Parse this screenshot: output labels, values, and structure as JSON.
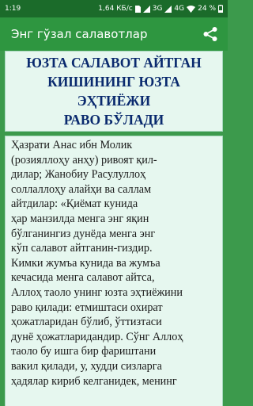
{
  "status_bar": {
    "time": "1:19",
    "network_speed": "1,64 КБ/с",
    "network_3g": "3G",
    "network_4g": "4G",
    "battery": "24 %",
    "icons": [
      "sim-icon",
      "signal-icon",
      "wifi-icon",
      "battery-icon"
    ]
  },
  "app_bar": {
    "title": "Энг гўзал салавотлар",
    "share_icon": "share-icon"
  },
  "heading": {
    "lines": [
      "ЮЗТА САЛАВОТ АЙТГАН",
      "КИШИНИНГ ЮЗТА ЭҲТИЁЖИ",
      "РАВО БЎЛАДИ"
    ]
  },
  "body": {
    "lines": [
      "Ҳазрати Анас ибн Молик",
      "(розияллоҳу анҳу) ривоят қил-",
      "дилар; Жанобиу Расулуллоҳ",
      "соллаллоҳу алайҳи ва саллам",
      "айтдилар: «Қиёмат кунида",
      "ҳар манзилда менга энг яқин",
      "бўлганингиз дунёда менга энг",
      "кўп салавот айтганин-гиздир.",
      "Кимки жумъа кунида ва жумъа",
      "кечасида менга салавот айтса,",
      "Аллоҳ таоло унинг юзта эҳтиёжини",
      "раво қилади: етмиштаси охират",
      "ҳожатларидан бўлиб, ўттизтаси",
      "дунё ҳожатларидандир. Сўнг Аллоҳ",
      "таоло бу ишга бир фариштани",
      "вакил қилади, у, худди сизларга",
      "ҳадялар кириб келганидек, менинг"
    ]
  },
  "colors": {
    "status_bar": "#1b6b2a",
    "app_bar": "#2e9640",
    "background": "#3c9a4c",
    "card": "#e6f7ef",
    "heading_text": "#0a2a6e",
    "body_text": "#1a1a1a"
  }
}
